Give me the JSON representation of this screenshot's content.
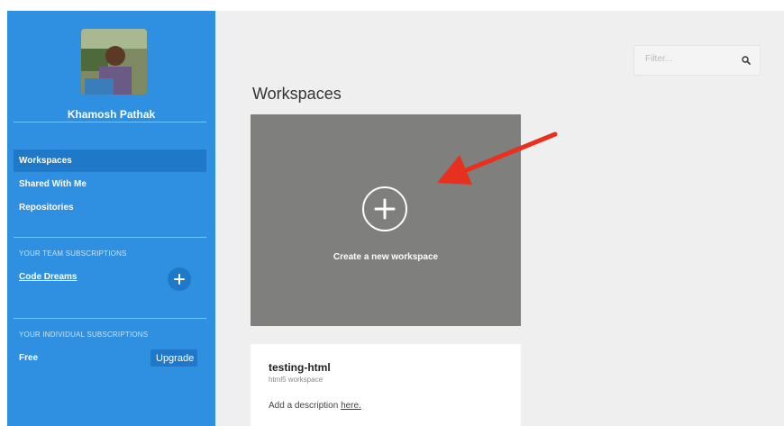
{
  "user": {
    "name": "Khamosh Pathak"
  },
  "nav": {
    "items": [
      {
        "label": "Workspaces",
        "active": true
      },
      {
        "label": "Shared With Me",
        "active": false
      },
      {
        "label": "Repositories",
        "active": false
      }
    ]
  },
  "team_subscriptions": {
    "title": "YOUR TEAM SUBSCRIPTIONS",
    "team_name": "Code Dreams",
    "add_icon": "plus-icon"
  },
  "individual_subscriptions": {
    "title": "YOUR INDIVIDUAL SUBSCRIPTIONS",
    "plan": "Free",
    "upgrade_label": "Upgrade"
  },
  "filter": {
    "placeholder": "Filter...",
    "icon": "search-icon"
  },
  "page": {
    "title": "Workspaces"
  },
  "create_tile": {
    "label": "Create a new workspace",
    "icon": "plus-icon"
  },
  "workspace": {
    "name": "testing-html",
    "type": "html5 workspace",
    "description_prefix": "Add a description",
    "description_link": "here."
  },
  "colors": {
    "sidebar": "#2f8fe0",
    "sidebar_active": "#1f78c8",
    "main_bg": "#efefef",
    "tile": "#7f7f7e",
    "arrow": "#e8301e"
  }
}
